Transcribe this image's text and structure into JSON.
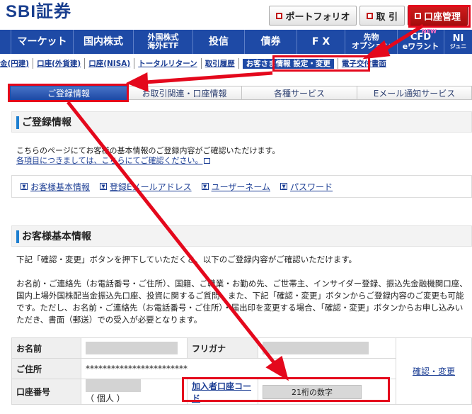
{
  "header": {
    "logo": "SBI証券",
    "buttons": [
      {
        "label": "ポートフォリオ",
        "icon": "square-icon"
      },
      {
        "label": "取 引",
        "icon": "square-icon"
      },
      {
        "label": "口座管理",
        "icon": "square-icon"
      }
    ]
  },
  "mainnav": {
    "items": [
      "マーケット",
      "国内株式",
      "外国株式",
      "海外ETF",
      "投信",
      "債券",
      "F X",
      "先物",
      "オプション",
      "CFD",
      "eワラント",
      "NEW",
      "NI",
      "ジュニ"
    ]
  },
  "subnav": {
    "items": [
      "金(円建)",
      "口座(外貨建)",
      "口座(NISA)",
      "トータルリターン",
      "取引履歴",
      "お客さま情報 設定・変更",
      "電子交付書面"
    ]
  },
  "tabs": [
    "ご登録情報",
    "お取引関連・口座情報",
    "各種サービス",
    "Eメール通知サービス"
  ],
  "section1": {
    "title": "ご登録情報",
    "text": "こちらのページにてお客様の基本情報のご登録内容がご確認いただけます。",
    "link": "各項目につきましては、こちらにてご確認ください。"
  },
  "anchors": [
    "お客様基本情報",
    "登録Eメールアドレス",
    "ユーザーネーム",
    "パスワード"
  ],
  "section2": {
    "title": "お客様基本情報",
    "para1": "下記「確認・変更」ボタンを押下していただくと、以下のご登録内容がご確認いただけます。",
    "para2": "お名前・ご連絡先（お電話番号・ご住所）、国籍、ご職業・お勤め先、ご世帯主、インサイダー登録、振込先金融機関口座、国内上場外国株配当金振込先口座、投資に関するご質問、また、下記「確認・変更」ボタンからご登録内容のご変更も可能です。ただし、お名前・ご連絡先（お電話番号・ご住所）・届出印を変更する場合、「確認・変更」ボタンからお申し込みいただき、書面（郵送）での受入が必要となります。"
  },
  "table": {
    "name_label": "お名前",
    "furigana_label": "フリガナ",
    "address_label": "ご住所",
    "address_value": "************************",
    "account_label": "口座番号",
    "account_suffix": "（ 個人 ）",
    "member_code_label": "加入者口座コード",
    "member_code_value": "21桁の数字",
    "confirm_link": "確認・変更"
  },
  "colors": {
    "nav_blue": "#1e4aa6",
    "highlight_red": "#e4081c",
    "link_blue": "#1c3e94"
  }
}
